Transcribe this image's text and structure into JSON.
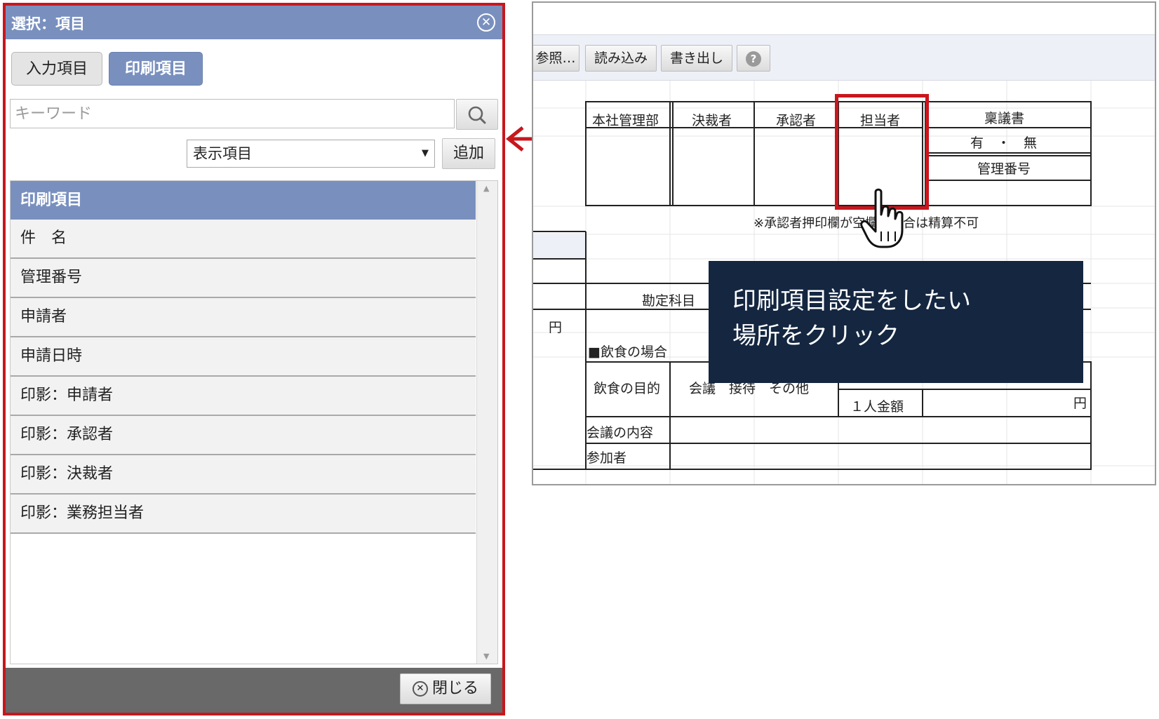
{
  "dialog": {
    "title": "選択：項目",
    "close_icon": "close-icon",
    "tabs": [
      {
        "label": "入力項目",
        "active": false
      },
      {
        "label": "印刷項目",
        "active": true
      }
    ],
    "search": {
      "placeholder": "キーワード",
      "value": "",
      "button_icon": "search-icon"
    },
    "select": {
      "value": "表示項目",
      "arrow": "▼"
    },
    "add_label": "追加",
    "list": {
      "header": "印刷項目",
      "items": [
        "件　名",
        "管理番号",
        "申請者",
        "申請日時",
        "印影：申請者",
        "印影：承認者",
        "印影：決裁者",
        "印影：業務担当者"
      ]
    },
    "footer": {
      "close_label": "閉じる"
    }
  },
  "sheet": {
    "toolbar": {
      "ref_label": "参照…",
      "read_label": "読み込み",
      "write_label": "書き出し",
      "help_label": "?"
    },
    "headers": [
      "本社管理部",
      "決裁者",
      "承認者",
      "担当者"
    ],
    "ringi_label": "稟議書",
    "umu": "有　・　無",
    "kanri_label": "管理番号",
    "note": "※承認者押印欄が空欄の場合は精算不可",
    "kanjo_label": "勘定科目",
    "yen": "円",
    "food_heading": "■飲食の場合",
    "food_purpose_label": "飲食の目的",
    "food_purpose_options": "会議　接待　その他",
    "per_person_label": "１人金額",
    "meeting_content_label": "会議の内容",
    "participants_label": "参加者"
  },
  "callout": {
    "line1": "印刷項目設定をしたい",
    "line2": "場所をクリック"
  },
  "colors": {
    "accent_red": "#c8161d",
    "header_blue": "#7990bf",
    "callout_navy": "#142640",
    "footer_gray": "#696969"
  }
}
